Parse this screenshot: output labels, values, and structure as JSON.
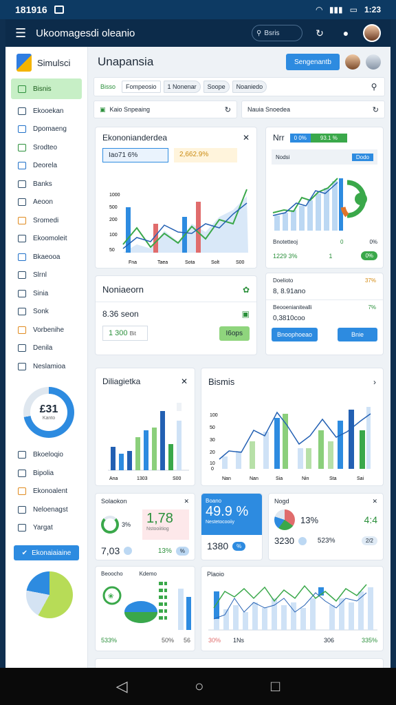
{
  "status": {
    "time": "181916",
    "right": "1:23"
  },
  "appbar": {
    "title": "Ukoomagesdi oleanio",
    "search_label": "Bsris"
  },
  "sidebar": {
    "brand": "Simulsci",
    "items": [
      {
        "label": "Bisnis",
        "active": true
      },
      {
        "label": "Ekooekan"
      },
      {
        "label": "Dpomaeng"
      },
      {
        "label": "Srodteo"
      },
      {
        "label": "Deorela"
      },
      {
        "label": "Banks"
      },
      {
        "label": "Aeoon"
      },
      {
        "label": "Sromedi"
      },
      {
        "label": "Ekoomoleit"
      },
      {
        "label": "Bkaeooa"
      },
      {
        "label": "Slrnl"
      },
      {
        "label": "Sinia"
      },
      {
        "label": "Sonk"
      },
      {
        "label": "Vorbenihe"
      },
      {
        "label": "Denila"
      },
      {
        "label": "Neslamioa"
      }
    ],
    "gauge_value": "£31",
    "gauge_label": "Kanto",
    "lower_items": [
      "Bkoeloqio",
      "Bipolia",
      "Ekonoalent",
      "Neloenagst",
      "Yargat"
    ],
    "cta": "Ekonaiaiaine"
  },
  "header": {
    "title": "Unapansia",
    "button": "Sengenantb"
  },
  "filters": {
    "chip1": "Bisso",
    "chip2": "Fompeosio",
    "chip3": "1 Nonenar",
    "chip4": "Soope",
    "chip5": "Noaniedo"
  },
  "fields": {
    "left": "Kaio Snpeaing",
    "right": "Nauia Snoedea"
  },
  "card_econ": {
    "title": "Ekononianderdea",
    "badge1": "Iao71 6%",
    "badge2": "2,662.9%",
    "y_ticks": [
      "1000",
      "500",
      "200",
      "100",
      "50"
    ],
    "x_ticks": [
      "Fna",
      "Taea",
      "Sota",
      "Solt",
      "S00"
    ]
  },
  "card_nr": {
    "title": "Nrr",
    "chip_blue": "0 0%",
    "chip_green": "93.1 %",
    "sub": "Nodsi",
    "tag": "Dodo",
    "row1a": "Bnotetteoj",
    "row1b": "0",
    "row1c": "0%",
    "row2a": "1229 3%",
    "row2b": "1",
    "row2c": "0%"
  },
  "card_nonie": {
    "title": "Noniaeorn",
    "value": "8.36 seon",
    "metric": "1 300",
    "metric_unit": "Bit",
    "button": "I6ops"
  },
  "card_list": {
    "l1": "Doelioto",
    "l1v": "8, 8.91ano",
    "l1p": "37%",
    "l2": "Beooenianitealli",
    "l2v": "0,3810coo",
    "l2p": "7%",
    "btn1": "Bnoophoeao",
    "btn2": "Bnie"
  },
  "card_diag": {
    "title": "Diliagietka",
    "x_ticks": [
      "Ana",
      "1303",
      "S00"
    ]
  },
  "card_bisnis": {
    "title": "Bismis",
    "y_ticks": [
      "100",
      "50",
      "30",
      "20",
      "10",
      "0"
    ],
    "x_ticks": [
      "Nan",
      "Nan",
      "Sia",
      "Nin",
      "Sta",
      "Sai"
    ]
  },
  "mini1": {
    "title": "Solaokon",
    "pct": "3%",
    "big": "1,78",
    "sub": "Nstooiitiog",
    "value": "7,03",
    "p2": "13%"
  },
  "mini2": {
    "title": "Boano",
    "big": "49.9 %",
    "sub": "Nestetocooiiy",
    "value": "1380"
  },
  "mini3": {
    "title": "Nogd",
    "pct": "13%",
    "big": "4:4",
    "value": "3230",
    "p2": "523%",
    "tag": "2/2"
  },
  "bottom1": {
    "title": "Beoocho",
    "title2": "Kdemo",
    "p1": "533%",
    "p2": "50%",
    "p3": "56"
  },
  "bottom2": {
    "title": "Plaoio",
    "p1": "30%",
    "p2": "1Ns",
    "p3": "306",
    "p4": "335%"
  }
}
